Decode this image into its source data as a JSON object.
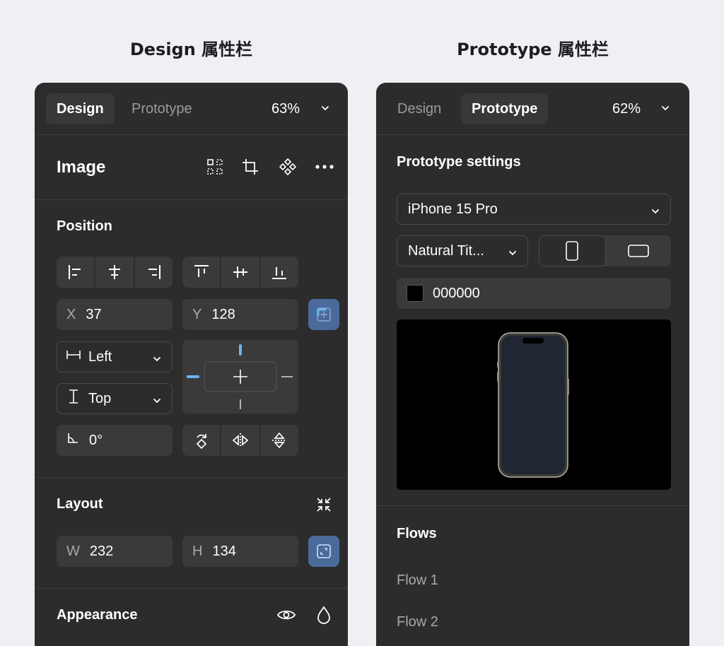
{
  "captions": {
    "design": "Design 属性栏",
    "prototype": "Prototype 属性栏"
  },
  "design_panel": {
    "tabs": {
      "design": "Design",
      "prototype": "Prototype",
      "active": "Design"
    },
    "zoom": "63%",
    "layer_title": "Image",
    "toolbar_icons": [
      "grid-select-icon",
      "crop-icon",
      "component-icon",
      "more-icon"
    ],
    "position": {
      "label": "Position",
      "align_horizontal": [
        "align-left-icon",
        "align-center-horizontal-icon",
        "align-right-icon"
      ],
      "align_vertical": [
        "align-top-icon",
        "align-center-vertical-icon",
        "align-bottom-icon"
      ],
      "x": {
        "prefix": "X",
        "value": "37"
      },
      "y": {
        "prefix": "Y",
        "value": "128"
      },
      "constraint_h": "Left",
      "constraint_v": "Top",
      "rotation": "0°",
      "transform_icons": [
        "rotate-icon",
        "flip-horizontal-icon",
        "flip-vertical-icon"
      ]
    },
    "layout": {
      "label": "Layout",
      "w": {
        "prefix": "W",
        "value": "232"
      },
      "h": {
        "prefix": "H",
        "value": "134"
      }
    },
    "appearance": {
      "label": "Appearance"
    }
  },
  "prototype_panel": {
    "tabs": {
      "design": "Design",
      "prototype": "Prototype",
      "active": "Prototype"
    },
    "zoom": "62%",
    "settings_title": "Prototype settings",
    "device": "iPhone 15 Pro",
    "device_model": "Natural Tit...",
    "orientation": {
      "selected": "portrait"
    },
    "background_color": {
      "hex_label": "000000",
      "swatch": "#000000"
    },
    "flows": {
      "label": "Flows",
      "items": [
        "Flow 1",
        "Flow 2"
      ]
    }
  },
  "colors": {
    "page_bg": "#eef0f4",
    "panel_bg": "#2c2c2c",
    "field_bg": "#3a3a3a",
    "accent_blue": "#4a6a9c",
    "constraint_blue": "#6eb3f2"
  }
}
